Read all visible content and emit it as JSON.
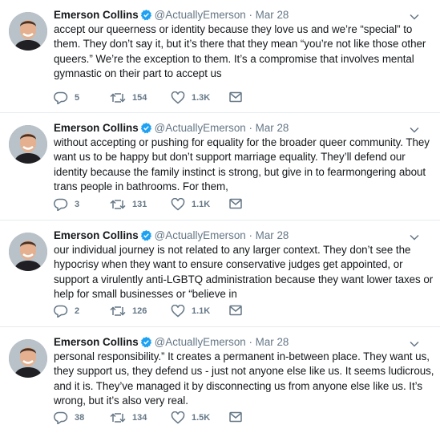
{
  "tweets": [
    {
      "name": "Emerson Collins",
      "handle": "@ActuallyEmerson",
      "separator": "·",
      "date": "Mar 28",
      "lines": [
        "accept our queerness or identity because they love us and we’re “special” to",
        "them. They don’t say it, but it’s there that they mean “you’re not like those other",
        "queers.” We’re the exception to them. It’s a compromise that involves mental",
        "gymnastic on their part to accept us"
      ],
      "replies": "5",
      "retweets": "154",
      "likes": "1.3K"
    },
    {
      "name": "Emerson Collins",
      "handle": "@ActuallyEmerson",
      "separator": "·",
      "date": "Mar 28",
      "lines": [
        "without accepting or pushing for equality for the broader queer community. They",
        "want us to be happy but don’t support marriage equality. They’ll defend our",
        "identity because the family instinct is strong, but give in to fearmongering about",
        "trans people in bathrooms. For them,"
      ],
      "replies": "3",
      "retweets": "131",
      "likes": "1.1K"
    },
    {
      "name": "Emerson Collins",
      "handle": "@ActuallyEmerson",
      "separator": "·",
      "date": "Mar 28",
      "lines": [
        "our individual journey is not related to any larger context. They don’t see the",
        "hypocrisy when they want to ensure conservative judges get appointed, or",
        "support a virulently anti-LGBTQ administration because they want lower taxes or",
        "help for small businesses or “believe in"
      ],
      "replies": "2",
      "retweets": "126",
      "likes": "1.1K"
    },
    {
      "name": "Emerson Collins",
      "handle": "@ActuallyEmerson",
      "separator": "·",
      "date": "Mar 28",
      "lines": [
        "personal responsibility.” It creates a permanent in-between place. They want us,",
        "they support us, they defend us - just not anyone else like us. It seems ludicrous,",
        "and it is. They’ve managed it by disconnecting us from anyone else like us. It’s",
        "wrong, but it’s also very real."
      ],
      "replies": "38",
      "retweets": "134",
      "likes": "1.5K"
    }
  ],
  "icons": {
    "reply": "reply-icon",
    "retweet": "retweet-icon",
    "like": "heart-icon",
    "dm": "envelope-icon",
    "verified": "verified-badge-icon",
    "caret": "chevron-down-icon"
  },
  "colors": {
    "verified": "#1da1f2",
    "muted": "#657786",
    "text": "#14171a"
  }
}
